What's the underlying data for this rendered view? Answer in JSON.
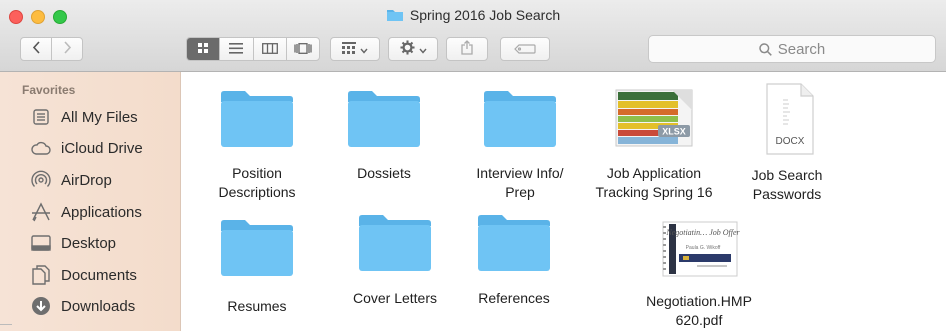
{
  "window": {
    "title": "Spring 2016 Job Search"
  },
  "toolbar": {
    "back_icon": "chevron-left-icon",
    "forward_icon": "chevron-right-icon",
    "views": [
      "icon-view-icon",
      "list-view-icon",
      "column-view-icon",
      "cover-flow-icon"
    ],
    "arrange_icon": "arrange-grid-icon",
    "action_icon": "gear-icon",
    "share_icon": "share-icon",
    "tags_icon": "tag-icon",
    "search_placeholder": "Search",
    "accent_color": "#6b6b6b"
  },
  "sidebar": {
    "heading": "Favorites",
    "items": [
      {
        "label": "All My Files",
        "icon": "all-files-icon"
      },
      {
        "label": "iCloud Drive",
        "icon": "cloud-icon"
      },
      {
        "label": "AirDrop",
        "icon": "airdrop-icon"
      },
      {
        "label": "Applications",
        "icon": "applications-icon"
      },
      {
        "label": "Desktop",
        "icon": "desktop-icon"
      },
      {
        "label": "Documents",
        "icon": "documents-icon"
      },
      {
        "label": "Downloads",
        "icon": "downloads-icon"
      }
    ]
  },
  "files": [
    {
      "label": "Position\nDescriptions",
      "kind": "folder"
    },
    {
      "label": "Dossiets",
      "kind": "folder"
    },
    {
      "label": "Interview Info/\nPrep",
      "kind": "folder"
    },
    {
      "label": "Job Application\nTracking Spring 16",
      "kind": "xlsx",
      "badge": "XLSX"
    },
    {
      "label": "Job Search\nPasswords",
      "kind": "docx",
      "badge": "DOCX"
    },
    {
      "label": "Resumes",
      "kind": "folder"
    },
    {
      "label": "Cover Letters",
      "kind": "folder"
    },
    {
      "label": "References",
      "kind": "folder"
    },
    {
      "label": "Negotiation.HMP\n620.pdf",
      "kind": "pdf",
      "preview_title": "Negotiatin… Job Offer",
      "preview_author": "Paula G. Wikoff"
    }
  ],
  "colors": {
    "folder": "#6fc4f4",
    "folder_tab": "#5ab3e8",
    "sidebar_bg": "#f5e0d1"
  }
}
